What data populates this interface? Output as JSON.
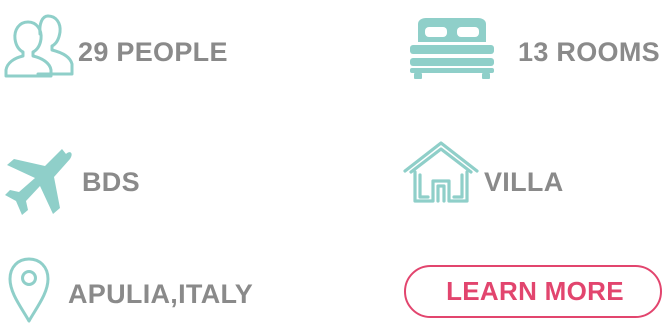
{
  "features": {
    "guests": {
      "label": "29 PEOPLE",
      "icon": "people-icon"
    },
    "rooms": {
      "label": "13 ROOMS",
      "icon": "bed-icon"
    },
    "airport": {
      "label": "BDS",
      "icon": "airplane-icon"
    },
    "property_type": {
      "label": "VILLA",
      "icon": "house-icon"
    },
    "location": {
      "label": "APULIA,ITALY",
      "icon": "map-pin-icon"
    }
  },
  "cta": {
    "label": "LEARN MORE"
  },
  "colors": {
    "icon_accent": "#8fcfc9",
    "label_text": "#8a8a8a",
    "cta_accent": "#e2456e"
  }
}
